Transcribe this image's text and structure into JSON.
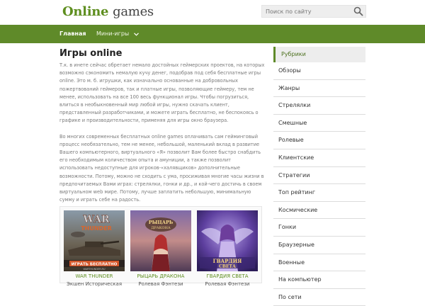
{
  "header": {
    "logo_word1": "Online",
    "logo_word2": "games",
    "search_placeholder": "Поиск по сайту"
  },
  "nav": {
    "home": "Главная",
    "mini": "Мини-игры"
  },
  "main": {
    "title": "Игры online",
    "paragraph1": "Т.к. в инете сейчас обретает немало достойных геймерских проектов, на которых возможно сэкономить немалую кучу денег, подобрав под себя бесплатные игры online. Это м. б. игрушки, как изначально основанные на добровольных пожертвований геймеров, так и платные игры, позволяющие геймеру, тем не менее, использовать на все 100 весь функционал игры. Чтобы погрузиться, влиться в необыкновенный мир любой игры, нужно скачать клиент, представленный разработчиками, и можете играть бесплатно, не беспокоясь о графике и производительности, применяя для игры окно браузера.",
    "paragraph2": "Во многих современных бесплатных online games оплачивать сам гейминговый процесс необязательно, тем не менее, небольшой, маленький вклад в развитие Вашего компьютерного, виртуального «Я» позволит Вам более быстро снабдить его необходимым количеством опыта и амуниции, а также позволит использовать недоступные для игроков-«халявщиков» дополнительные возможности. Потому, можно не сходить с ума, просиживая многие часы жизни в предпочитаемых Вами играх: стрелялки, гонки и др., и кой-чего достичь в своем виртуальном web мире. Потому, лучше заплатить небольшую, минимальную сумму и играть себе на радость."
  },
  "games": [
    {
      "name": "WAR THUNDER",
      "sub": "Экшен Историческая",
      "logo": "WAR",
      "logo2": "THUNDER",
      "button": "ИГРАТЬ БЕСПЛАТНО",
      "footer": "WARTHUNDER.RU"
    },
    {
      "name": "РЫЦАРЬ ДРАКОНА",
      "sub": "Ролевая Фэнтези",
      "logo": "РЫЦАРЬ",
      "logo2": "ДРАКОНА"
    },
    {
      "name": "ГВАРДИЯ СВЕТА",
      "sub": "Ролевая Фэнтези",
      "logo": "ГВАРДИЯ",
      "logo2": "СВЕТА"
    }
  ],
  "sidebar": {
    "title": "Рубрики",
    "items": [
      "Обзоры",
      "Жанры",
      "Стрелялки",
      "Смешные",
      "Ролевые",
      "Клиентские",
      "Стратегии",
      "Топ рейтинг",
      "Космические",
      "Гонки",
      "Браузерные",
      "Военные",
      "На компьютер",
      "По сети"
    ]
  }
}
